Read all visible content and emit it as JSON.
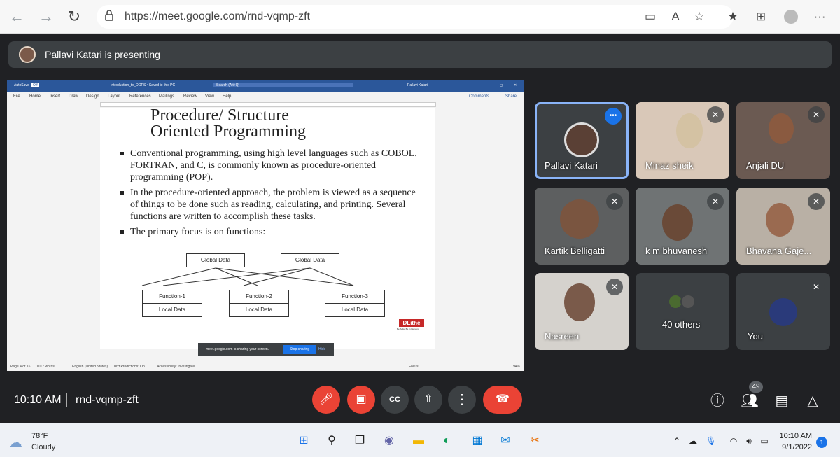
{
  "browser": {
    "url": "https://meet.google.com/rnd-vqmp-zft",
    "back": "←",
    "forward": "→",
    "refresh": "↻",
    "menu": "···"
  },
  "presenting": {
    "text": "Pallavi Katari is presenting"
  },
  "word": {
    "autosave": "AutoSave",
    "autosave_state": "Off",
    "doc_name": "Introduction_to_OOPS • Saved to this PC",
    "search": "Search (Alt+Q)",
    "user": "Pallavi Katari",
    "menu": [
      "File",
      "Home",
      "Insert",
      "Draw",
      "Design",
      "Layout",
      "References",
      "Mailings",
      "Review",
      "View",
      "Help"
    ],
    "comments": "Comments",
    "share": "Share",
    "status_page": "Page 4 of 16",
    "status_words": "1017 words",
    "status_lang": "English (United States)",
    "status_predictions": "Text Predictions: On",
    "status_access": "Accessibility: Investigate",
    "status_focus": "Focus",
    "zoom": "94%"
  },
  "doc": {
    "title_line1": "Procedure/ Structure",
    "title_line2": "Oriented Programming",
    "bullets": [
      "Conventional programming, using high level languages such as COBOL, FORTRAN, and C, is commonly known as procedure-oriented programming (POP).",
      "In the procedure-oriented approach, the problem is viewed as a sequence of things to be done such as reading, calculating, and printing. Several functions are written to accomplish these tasks.",
      "The primary focus is on functions:"
    ],
    "diagram": {
      "global1": "Global Data",
      "global2": "Global Data",
      "functions": [
        "Function-1",
        "Function-2",
        "Function-3"
      ],
      "local": [
        "Local Data",
        "Local Data",
        "Local Data"
      ]
    },
    "logo": "DLithe",
    "logo_tagline": "Be Agile, Be in Demand"
  },
  "share_bar": {
    "text": "meet.google.com is sharing your screen.",
    "stop": "Stop sharing",
    "hide": "Hide"
  },
  "tiles": [
    {
      "name": "Pallavi Katari",
      "menu": "•••"
    },
    {
      "name": "Minaz sheik"
    },
    {
      "name": "Anjali DU"
    },
    {
      "name": "Kartik Belligatti"
    },
    {
      "name": "k m bhuvanesh"
    },
    {
      "name": "Bhavana Gaje..."
    },
    {
      "name": "Nasreen"
    },
    {
      "name": "40 others"
    },
    {
      "name": "You"
    }
  ],
  "meeting": {
    "time": "10:10 AM",
    "code": "rnd-vqmp-zft",
    "participants": "49",
    "colors": {
      "red": "#ea4335",
      "gray": "#3c4043",
      "accent": "#1a73e8"
    }
  },
  "taskbar": {
    "temp": "78°F",
    "condition": "Cloudy",
    "time": "10:10 AM",
    "date": "9/1/2022",
    "notifications": "1"
  }
}
